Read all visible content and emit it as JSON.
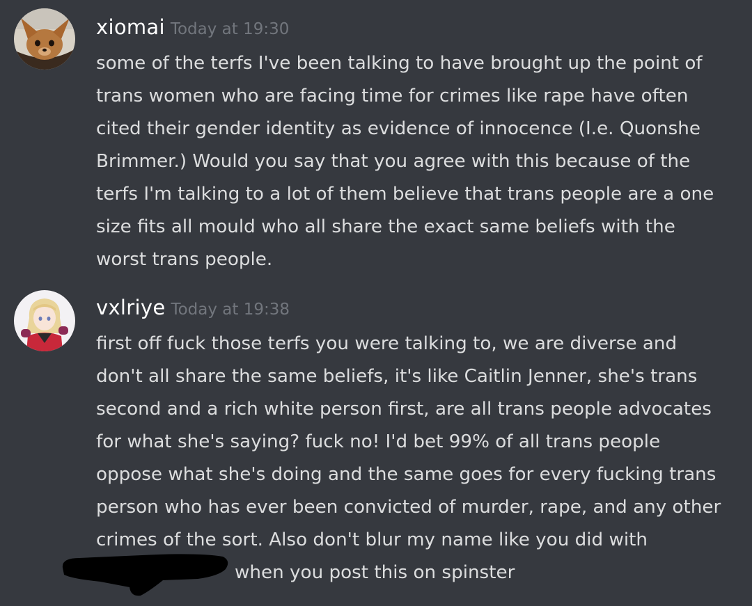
{
  "messages": [
    {
      "username": "xiomai",
      "timestamp": "Today at 19:30",
      "avatar_icon": "chihuahua-avatar-icon",
      "lines": [
        "some of the terfs I've been talking to have brought up the point of",
        "trans women who are facing time for crimes like rape have often",
        "cited their gender identity as evidence of innocence (I.e. Quonshe",
        "Brimmer.) Would you say that you agree with this because of the",
        "terfs I'm talking to a lot of them believe that trans people are a one",
        "size fits all mould who all share the exact same beliefs with the",
        "worst trans people."
      ]
    },
    {
      "username": "vxlriye",
      "timestamp": "Today at 19:38",
      "avatar_icon": "anime-girl-avatar-icon",
      "lines": [
        "first off fuck those terfs you were talking to, we are diverse and",
        "don't all share the same beliefs, it's like Caitlin Jenner, she's trans",
        "second and a rich white person first, are all trans people advocates",
        "for what she's saying? fuck no! I'd bet 99% of all trans people",
        "oppose what she's doing and the same goes for every fucking trans",
        "person who has ever been convicted of murder, rape, and any other",
        "crimes of the sort. Also don't blur my name like you did with"
      ],
      "last_line": "when you post this on spinster"
    }
  ],
  "colors": {
    "background": "#36393f",
    "username": "#ffffff",
    "timestamp": "#72767d",
    "text": "#dcddde",
    "redaction": "#000000"
  }
}
